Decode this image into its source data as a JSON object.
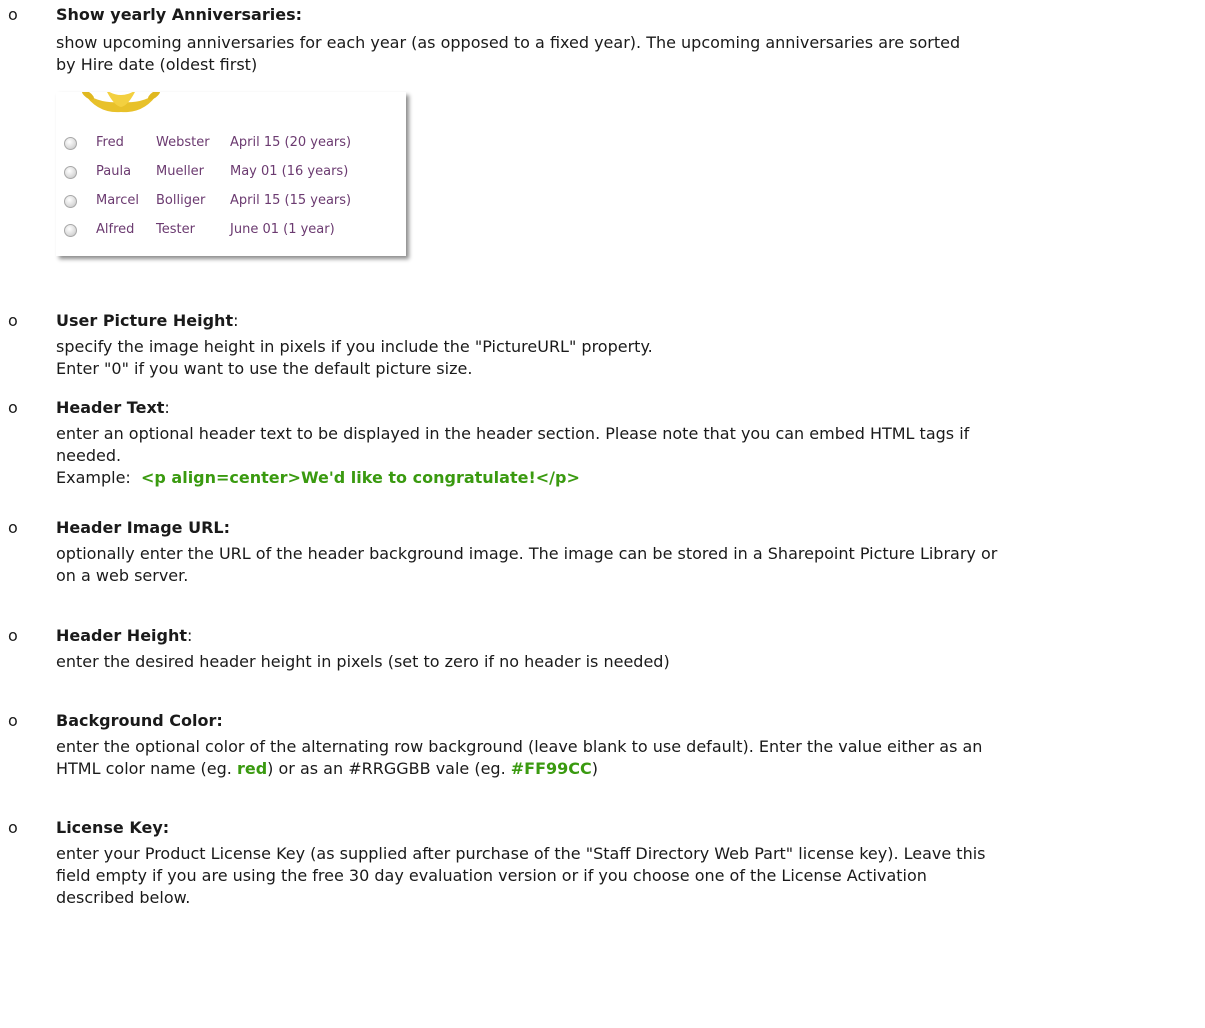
{
  "items": [
    {
      "title": "Show yearly Anniversaries:",
      "lines": [
        "show upcoming anniversaries for each year (as opposed to a fixed year). The upcoming anniversaries are sorted",
        "by Hire date (oldest first)"
      ]
    },
    {
      "title": "User Picture Height",
      "title_colon": ":",
      "lines": [
        "specify the image height in pixels if you include the \"PictureURL\" property.",
        "Enter \"0\" if you want to use the default picture size."
      ]
    },
    {
      "title": "Header Text",
      "title_colon": ":",
      "lines": [
        "enter an optional header text to be displayed in the header section. Please note that you can embed HTML tags if",
        "needed."
      ],
      "example_label": "Example:",
      "example_code": "<p align=center>We'd like to congratulate!</p>"
    },
    {
      "title": "Header Image URL:",
      "lines": [
        "optionally enter the URL of the header background image. The image can be stored in a Sharepoint Picture Library or",
        "on a web server."
      ]
    },
    {
      "title": "Header Height",
      "title_colon": ":",
      "lines": [
        "enter the desired header height in pixels (set to zero if no header is needed)"
      ]
    },
    {
      "title": "Background Color:",
      "lines": [
        "enter the optional color of the alternating row background (leave blank to use default). Enter the value either as an"
      ],
      "line2_a": "HTML color name (eg. ",
      "line2_red": "red",
      "line2_b": ") or as an  #RRGGBB vale (eg. ",
      "line2_hex": "#FF99CC",
      "line2_c": ")"
    },
    {
      "title": "License Key:",
      "lines": [
        "enter your Product License Key (as supplied after purchase of the \"Staff Directory Web Part\" license key). Leave this",
        "field empty if you are using the free 30 day evaluation version or if you choose one of the License Activation",
        "described below."
      ]
    }
  ],
  "bullet_symbol": "o",
  "widget": {
    "rows": [
      {
        "first": "Fred",
        "last": "Webster",
        "date": "April 15 (20 years)"
      },
      {
        "first": "Paula",
        "last": "Mueller",
        "date": "May 01 (16 years)"
      },
      {
        "first": "Marcel",
        "last": "Bolliger",
        "date": "April 15 (15 years)"
      },
      {
        "first": "Alfred",
        "last": "Tester",
        "date": "June 01 (1 year)"
      }
    ],
    "laurel_icon": "laurel-wreath-icon",
    "text_color": "#6b3a70"
  },
  "colors": {
    "green": "#3a9a10"
  }
}
